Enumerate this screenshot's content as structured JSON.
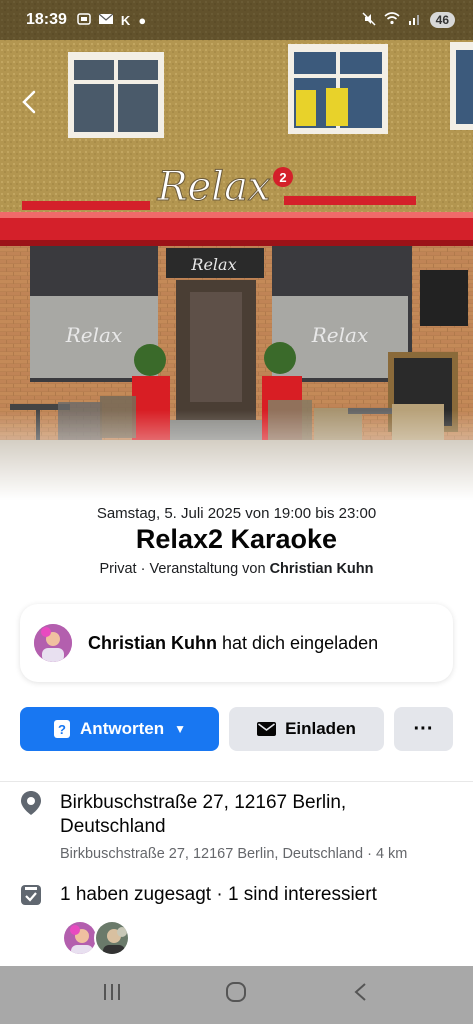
{
  "status_bar": {
    "time": "18:39",
    "notification_icons": [
      "screenshot-icon",
      "mail-icon",
      "k-icon",
      "dot-icon"
    ],
    "status_icons": [
      "mute-icon",
      "wifi-icon",
      "signal-icon"
    ],
    "battery": "46"
  },
  "hero": {
    "sign_text": "Relax",
    "sign_number": "2"
  },
  "event": {
    "date_time": "Samstag, 5. Juli 2025 von 19:00 bis 23:00",
    "title": "Relax2 Karaoke",
    "privacy": "Privat · Veranstaltung von ",
    "host": "Christian Kuhn"
  },
  "invite": {
    "inviter": "Christian Kuhn",
    "suffix": " hat dich eingeladen"
  },
  "actions": {
    "reply_label": "Antworten",
    "invite_label": "Einladen",
    "more_label": "···"
  },
  "details": {
    "address_main": "Birkbuschstraße 27, 12167 Berlin, Deutschland",
    "address_sub": "Birkbuschstraße 27, 12167 Berlin, Deutschland · 4 km",
    "attendance": "1 haben zugesagt · 1 sind interessiert"
  },
  "colors": {
    "primary": "#1877f2",
    "secondary_button": "#e4e6eb",
    "awning_red": "#d4202a"
  }
}
